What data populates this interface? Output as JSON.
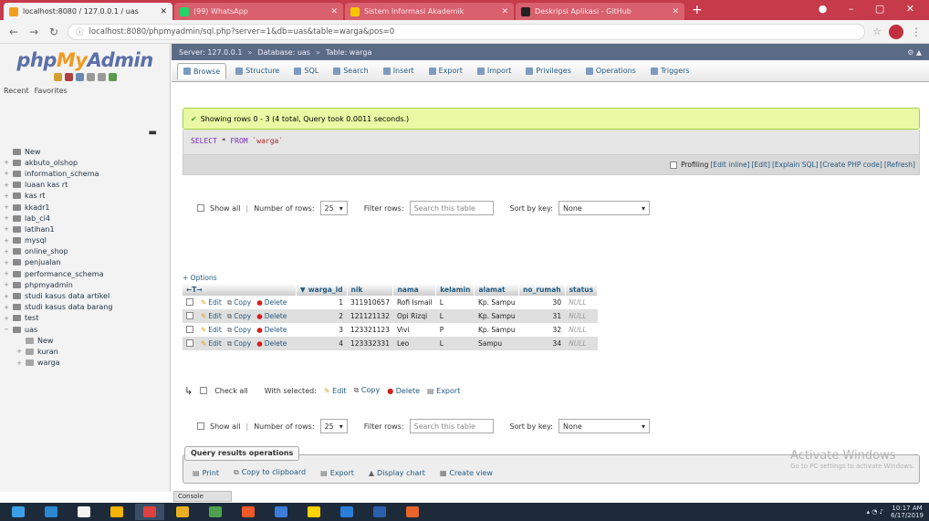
{
  "browser": {
    "tabs": [
      {
        "title": "localhost:8080 / 127.0.0.1 / uas",
        "active": true,
        "color": "#f0a020"
      },
      {
        "title": "(99) WhatsApp",
        "active": false,
        "color": "#25d366"
      },
      {
        "title": "Sistem Informasi Akademik",
        "active": false,
        "color": "#f7c600"
      },
      {
        "title": "Deskripsi Aplikasi - GitHub",
        "active": false,
        "color": "#222222"
      }
    ],
    "new_tab": "+",
    "window_controls": "● – ▢ ✕",
    "url": "localhost:8080/phpmyadmin/sql.php?server=1&db=uas&table=warga&pos=0",
    "lock": "ⓘ"
  },
  "nav": {
    "logo_php": "php",
    "logo_my": "My",
    "logo_admin": "Admin",
    "recent": "Recent",
    "favorites": "Favorites",
    "collapse": "▬",
    "databases": [
      {
        "name": "New",
        "expander": "",
        "sub": false
      },
      {
        "name": "akbuto_olshop",
        "expander": "+",
        "sub": false
      },
      {
        "name": "information_schema",
        "expander": "+",
        "sub": false
      },
      {
        "name": "luaan kas rt",
        "expander": "+",
        "sub": false
      },
      {
        "name": "kas rt",
        "expander": "+",
        "sub": false
      },
      {
        "name": "kkadr1",
        "expander": "+",
        "sub": false
      },
      {
        "name": "lab_ci4",
        "expander": "+",
        "sub": false
      },
      {
        "name": "latihan1",
        "expander": "+",
        "sub": false
      },
      {
        "name": "mysql",
        "expander": "+",
        "sub": false
      },
      {
        "name": "online_shop",
        "expander": "+",
        "sub": false
      },
      {
        "name": "penjualan",
        "expander": "+",
        "sub": false
      },
      {
        "name": "performance_schema",
        "expander": "+",
        "sub": false
      },
      {
        "name": "phpmyadmin",
        "expander": "+",
        "sub": false
      },
      {
        "name": "studi kasus data artikel",
        "expander": "+",
        "sub": false
      },
      {
        "name": "studi kasus data barang",
        "expander": "+",
        "sub": false
      },
      {
        "name": "test",
        "expander": "+",
        "sub": false
      },
      {
        "name": "uas",
        "expander": "−",
        "sub": false
      },
      {
        "name": "New",
        "expander": "",
        "sub": true
      },
      {
        "name": "kuran",
        "expander": "+",
        "sub": true
      },
      {
        "name": "warga",
        "expander": "+",
        "sub": true
      }
    ]
  },
  "crumb": {
    "server": "Server: 127.0.0.1",
    "database": "Database: uas",
    "table": "Table: warga",
    "sep": "»",
    "controls": "⚙ ▲"
  },
  "tabs": [
    "Browse",
    "Structure",
    "SQL",
    "Search",
    "Insert",
    "Export",
    "Import",
    "Privileges",
    "Operations",
    "Triggers"
  ],
  "success_msg": "Showing rows 0 - 3 (4 total, Query took 0.0011 seconds.)",
  "success_check": "✔",
  "sql": {
    "select": "SELECT",
    "star": " * ",
    "from": "FROM",
    "table": " `warga`"
  },
  "profiling": {
    "label": "Profiling",
    "links": [
      "[Edit inline]",
      "[Edit]",
      "[Explain SQL]",
      "[Create PHP code]",
      "[Refresh]"
    ]
  },
  "paging": {
    "show_all": "Show all",
    "rows_label": "Number of rows:",
    "rows_value": "25",
    "filter_label": "Filter rows:",
    "filter_placeholder": "Search this table",
    "sort_label": "Sort by key:",
    "sort_value": "None",
    "caret": "▾",
    "pipe": "|"
  },
  "options_label": "+ Options",
  "table": {
    "nav_arrows": "←T→",
    "sort_icon": "▼",
    "columns": [
      "warga_id",
      "nik",
      "nama",
      "kelamin",
      "alamat",
      "no_rumah",
      "status"
    ],
    "actions": {
      "edit": "Edit",
      "copy": "Copy",
      "delete": "Delete"
    },
    "rows": [
      [
        "1",
        "311910657",
        "Rofi Ismail",
        "L",
        "Kp. Sampu",
        "30",
        "NULL"
      ],
      [
        "2",
        "121121132",
        "Opi Rizqi",
        "L",
        "Kp. Sampu",
        "31",
        "NULL"
      ],
      [
        "3",
        "123321123",
        "Vivi",
        "P",
        "Kp. Sampu",
        "32",
        "NULL"
      ],
      [
        "4",
        "123332331",
        "Leo",
        "L",
        "Sampu",
        "34",
        "NULL"
      ]
    ]
  },
  "bulk": {
    "arrow": "↳",
    "check_all": "Check all",
    "with_selected": "With selected:",
    "edit": "Edit",
    "copy": "Copy",
    "delete": "Delete",
    "export": "Export"
  },
  "qro": {
    "legend": "Query results operations",
    "items": [
      "Print",
      "Copy to clipboard",
      "Export",
      "Display chart",
      "Create view"
    ]
  },
  "activate": {
    "title": "Activate Windows",
    "sub": "Go to PC settings to activate Windows."
  },
  "console": "Console",
  "taskbar": {
    "time": "10:17 AM",
    "date": "6/17/2019",
    "apps": [
      "#2a87d0",
      "#f2f2f2",
      "#f5b400",
      "#e04040",
      "#e8b020",
      "#4ea04e",
      "#f05a28",
      "#3b7dd8",
      "#ffd200",
      "#2a7ed8",
      "#2b5fae",
      "#e8642b"
    ]
  }
}
